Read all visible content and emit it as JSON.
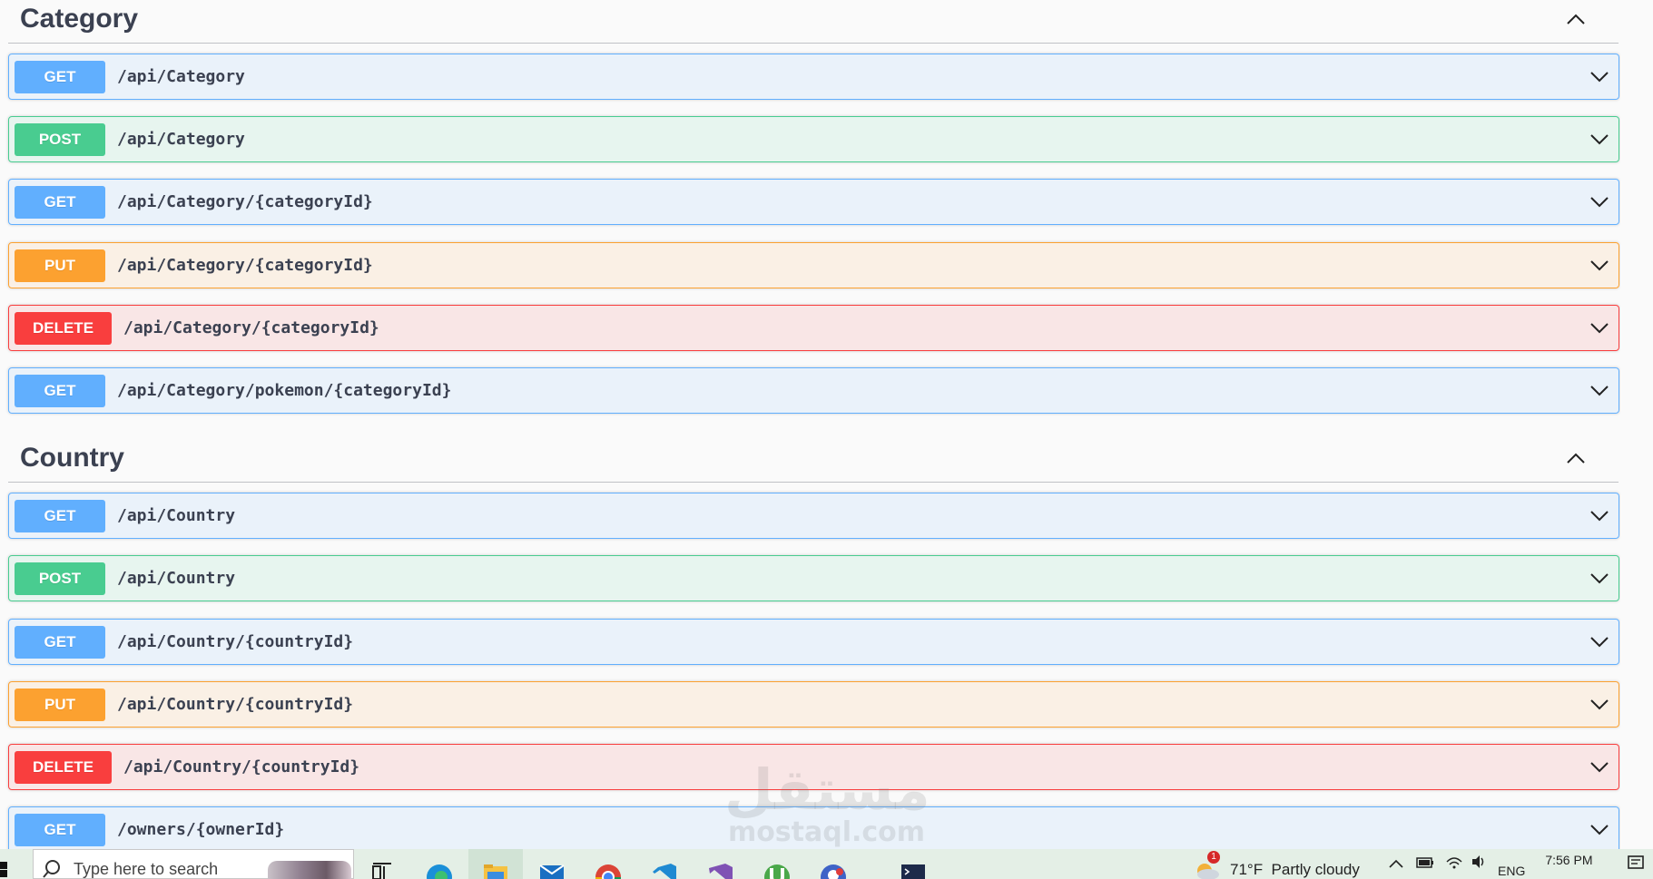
{
  "sections": [
    {
      "title": "Category",
      "operations": [
        {
          "method": "GET",
          "path": "/api/Category"
        },
        {
          "method": "POST",
          "path": "/api/Category"
        },
        {
          "method": "GET",
          "path": "/api/Category/{categoryId}"
        },
        {
          "method": "PUT",
          "path": "/api/Category/{categoryId}"
        },
        {
          "method": "DELETE",
          "path": "/api/Category/{categoryId}"
        },
        {
          "method": "GET",
          "path": "/api/Category/pokemon/{categoryId}"
        }
      ]
    },
    {
      "title": "Country",
      "operations": [
        {
          "method": "GET",
          "path": "/api/Country"
        },
        {
          "method": "POST",
          "path": "/api/Country"
        },
        {
          "method": "GET",
          "path": "/api/Country/{countryId}"
        },
        {
          "method": "PUT",
          "path": "/api/Country/{countryId}"
        },
        {
          "method": "DELETE",
          "path": "/api/Country/{countryId}"
        },
        {
          "method": "GET",
          "path": "/owners/{ownerId}"
        }
      ]
    }
  ],
  "colors": {
    "get": "#61affe",
    "post": "#49cc90",
    "put": "#fca130",
    "delete": "#f93e3e",
    "text": "#3b4151"
  },
  "watermark": {
    "arabic": "مستقل",
    "latin": "mostaql.com"
  },
  "taskbar": {
    "search_placeholder": "Type here to search",
    "weather_badge": "1",
    "weather": "71°F  Partly cloudy",
    "language": "ENG",
    "time": "7:56 PM",
    "pinned_icons": [
      "task-view-icon",
      "edge-icon",
      "file-explorer-icon",
      "mail-icon",
      "chrome-icon",
      "vscode-icon",
      "visual-studio-icon",
      "utorrent-icon",
      "app-icon",
      "terminal-icon"
    ]
  }
}
